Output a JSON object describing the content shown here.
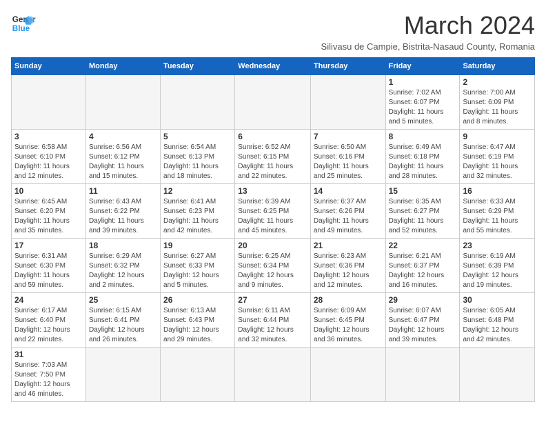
{
  "logo": {
    "text_general": "General",
    "text_blue": "Blue"
  },
  "header": {
    "title": "March 2024",
    "subtitle": "Silivasu de Campie, Bistrita-Nasaud County, Romania"
  },
  "calendar": {
    "columns": [
      "Sunday",
      "Monday",
      "Tuesday",
      "Wednesday",
      "Thursday",
      "Friday",
      "Saturday"
    ],
    "weeks": [
      [
        {
          "day": "",
          "info": "",
          "empty": true
        },
        {
          "day": "",
          "info": "",
          "empty": true
        },
        {
          "day": "",
          "info": "",
          "empty": true
        },
        {
          "day": "",
          "info": "",
          "empty": true
        },
        {
          "day": "",
          "info": "",
          "empty": true
        },
        {
          "day": "1",
          "info": "Sunrise: 7:02 AM\nSunset: 6:07 PM\nDaylight: 11 hours\nand 5 minutes."
        },
        {
          "day": "2",
          "info": "Sunrise: 7:00 AM\nSunset: 6:09 PM\nDaylight: 11 hours\nand 8 minutes."
        }
      ],
      [
        {
          "day": "3",
          "info": "Sunrise: 6:58 AM\nSunset: 6:10 PM\nDaylight: 11 hours\nand 12 minutes."
        },
        {
          "day": "4",
          "info": "Sunrise: 6:56 AM\nSunset: 6:12 PM\nDaylight: 11 hours\nand 15 minutes."
        },
        {
          "day": "5",
          "info": "Sunrise: 6:54 AM\nSunset: 6:13 PM\nDaylight: 11 hours\nand 18 minutes."
        },
        {
          "day": "6",
          "info": "Sunrise: 6:52 AM\nSunset: 6:15 PM\nDaylight: 11 hours\nand 22 minutes."
        },
        {
          "day": "7",
          "info": "Sunrise: 6:50 AM\nSunset: 6:16 PM\nDaylight: 11 hours\nand 25 minutes."
        },
        {
          "day": "8",
          "info": "Sunrise: 6:49 AM\nSunset: 6:18 PM\nDaylight: 11 hours\nand 28 minutes."
        },
        {
          "day": "9",
          "info": "Sunrise: 6:47 AM\nSunset: 6:19 PM\nDaylight: 11 hours\nand 32 minutes."
        }
      ],
      [
        {
          "day": "10",
          "info": "Sunrise: 6:45 AM\nSunset: 6:20 PM\nDaylight: 11 hours\nand 35 minutes."
        },
        {
          "day": "11",
          "info": "Sunrise: 6:43 AM\nSunset: 6:22 PM\nDaylight: 11 hours\nand 39 minutes."
        },
        {
          "day": "12",
          "info": "Sunrise: 6:41 AM\nSunset: 6:23 PM\nDaylight: 11 hours\nand 42 minutes."
        },
        {
          "day": "13",
          "info": "Sunrise: 6:39 AM\nSunset: 6:25 PM\nDaylight: 11 hours\nand 45 minutes."
        },
        {
          "day": "14",
          "info": "Sunrise: 6:37 AM\nSunset: 6:26 PM\nDaylight: 11 hours\nand 49 minutes."
        },
        {
          "day": "15",
          "info": "Sunrise: 6:35 AM\nSunset: 6:27 PM\nDaylight: 11 hours\nand 52 minutes."
        },
        {
          "day": "16",
          "info": "Sunrise: 6:33 AM\nSunset: 6:29 PM\nDaylight: 11 hours\nand 55 minutes."
        }
      ],
      [
        {
          "day": "17",
          "info": "Sunrise: 6:31 AM\nSunset: 6:30 PM\nDaylight: 11 hours\nand 59 minutes."
        },
        {
          "day": "18",
          "info": "Sunrise: 6:29 AM\nSunset: 6:32 PM\nDaylight: 12 hours\nand 2 minutes."
        },
        {
          "day": "19",
          "info": "Sunrise: 6:27 AM\nSunset: 6:33 PM\nDaylight: 12 hours\nand 5 minutes."
        },
        {
          "day": "20",
          "info": "Sunrise: 6:25 AM\nSunset: 6:34 PM\nDaylight: 12 hours\nand 9 minutes."
        },
        {
          "day": "21",
          "info": "Sunrise: 6:23 AM\nSunset: 6:36 PM\nDaylight: 12 hours\nand 12 minutes."
        },
        {
          "day": "22",
          "info": "Sunrise: 6:21 AM\nSunset: 6:37 PM\nDaylight: 12 hours\nand 16 minutes."
        },
        {
          "day": "23",
          "info": "Sunrise: 6:19 AM\nSunset: 6:39 PM\nDaylight: 12 hours\nand 19 minutes."
        }
      ],
      [
        {
          "day": "24",
          "info": "Sunrise: 6:17 AM\nSunset: 6:40 PM\nDaylight: 12 hours\nand 22 minutes."
        },
        {
          "day": "25",
          "info": "Sunrise: 6:15 AM\nSunset: 6:41 PM\nDaylight: 12 hours\nand 26 minutes."
        },
        {
          "day": "26",
          "info": "Sunrise: 6:13 AM\nSunset: 6:43 PM\nDaylight: 12 hours\nand 29 minutes."
        },
        {
          "day": "27",
          "info": "Sunrise: 6:11 AM\nSunset: 6:44 PM\nDaylight: 12 hours\nand 32 minutes."
        },
        {
          "day": "28",
          "info": "Sunrise: 6:09 AM\nSunset: 6:45 PM\nDaylight: 12 hours\nand 36 minutes."
        },
        {
          "day": "29",
          "info": "Sunrise: 6:07 AM\nSunset: 6:47 PM\nDaylight: 12 hours\nand 39 minutes."
        },
        {
          "day": "30",
          "info": "Sunrise: 6:05 AM\nSunset: 6:48 PM\nDaylight: 12 hours\nand 42 minutes."
        }
      ],
      [
        {
          "day": "31",
          "info": "Sunrise: 7:03 AM\nSunset: 7:50 PM\nDaylight: 12 hours\nand 46 minutes."
        },
        {
          "day": "",
          "info": "",
          "empty": true
        },
        {
          "day": "",
          "info": "",
          "empty": true
        },
        {
          "day": "",
          "info": "",
          "empty": true
        },
        {
          "day": "",
          "info": "",
          "empty": true
        },
        {
          "day": "",
          "info": "",
          "empty": true
        },
        {
          "day": "",
          "info": "",
          "empty": true
        }
      ]
    ]
  }
}
